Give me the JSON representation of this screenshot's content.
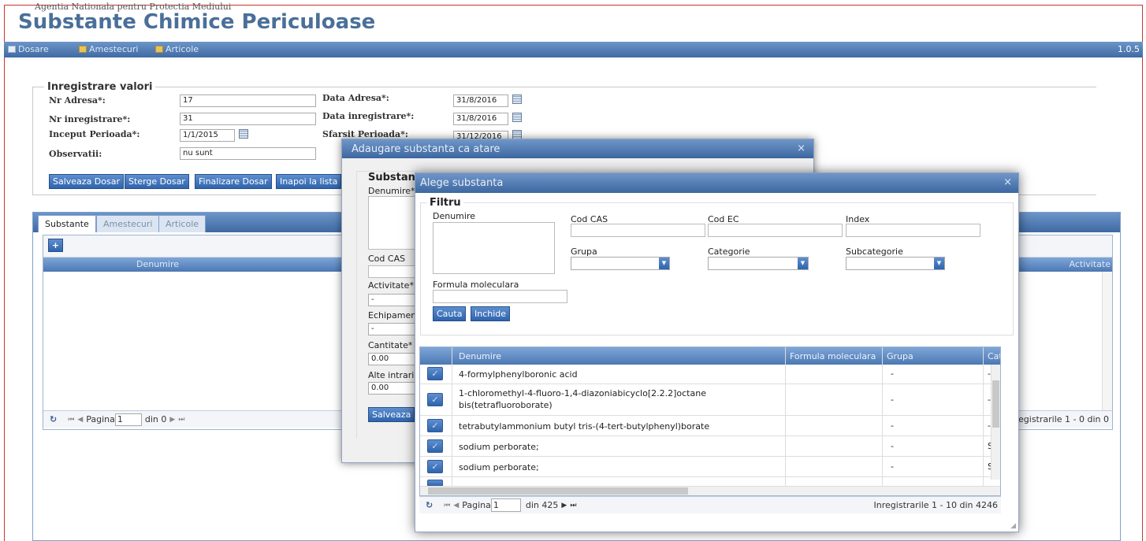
{
  "app": {
    "agency": "Agentia Nationala pentru Protectia Mediului",
    "title": "Substante Chimice Periculoase",
    "version": "1.0.5"
  },
  "menu": {
    "dosare": "Dosare",
    "amestecuri": "Amestecuri",
    "articole": "Articole"
  },
  "form": {
    "legend": "Inregistrare valori",
    "nr_adresa_label": "Nr Adresa*:",
    "nr_adresa_value": "17",
    "nr_inregistrare_label": "Nr inregistrare*:",
    "nr_inregistrare_value": "31",
    "inceput_label": "Inceput Perioada*:",
    "inceput_value": "1/1/2015",
    "observatii_label": "Observatii:",
    "observatii_value": "nu sunt",
    "data_adresa_label": "Data Adresa*:",
    "data_adresa_value": "31/8/2016",
    "data_inreg_label": "Data inregistrare*:",
    "data_inreg_value": "31/8/2016",
    "sfarsit_label": "Sfarsit Perioada*:",
    "sfarsit_value": "31/12/2016",
    "buttons": {
      "salveaza": "Salveaza Dosar",
      "sterge": "Sterge Dosar",
      "finalizare": "Finalizare Dosar",
      "inapoi": "Inapoi la lista"
    }
  },
  "tabs": {
    "substante": "Substante",
    "amestecuri": "Amestecuri",
    "articole": "Articole"
  },
  "main_grid": {
    "add": "+",
    "col_denumire": "Denumire",
    "col_activitate": "Activitate",
    "pager_pagina": "Pagina",
    "pager_page": "1",
    "pager_din": "din 0",
    "pager_info": "Inregistrarile 1 - 0 din 0"
  },
  "dialog1": {
    "title": "Adaugare substanta ca atare",
    "legend": "Substant",
    "denumire_label": "Denumire*",
    "cod_cas_label": "Cod CAS",
    "activitate_label": "Activitate*",
    "activitate_value": "-",
    "echipament_label": "Echipamen",
    "echipament_value": "-",
    "cantitate_label": "Cantitate*",
    "cantitate_value": "0.00",
    "alte_label": "Alte intrari",
    "alte_value": "0.00",
    "salveaza": "Salveaza"
  },
  "dialog2": {
    "title": "Alege substanta",
    "filter": {
      "legend": "Filtru",
      "denumire": "Denumire",
      "cod_cas": "Cod CAS",
      "cod_ec": "Cod EC",
      "index": "Index",
      "grupa": "Grupa",
      "categorie": "Categorie",
      "subcategorie": "Subcategorie",
      "formula": "Formula moleculara",
      "cauta": "Cauta",
      "inchide": "Inchide"
    },
    "grid": {
      "columns": [
        "Denumire",
        "Formula moleculara",
        "Grupa",
        "Cat"
      ],
      "rows": [
        {
          "denumire": "4-formylphenylboronic acid",
          "formula": "",
          "grupa": "-",
          "cat": "-"
        },
        {
          "denumire": "1-chloromethyl-4-fluoro-1,4-diazoniabicyclo[2.2.2]octane bis(tetrafluoroborate)",
          "line1": "1-chloromethyl-4-fluoro-1,4-diazoniabicyclo[2.2.2]octane",
          "line2": "bis(tetrafluoroborate)",
          "formula": "",
          "grupa": "-",
          "cat": "-"
        },
        {
          "denumire": "tetrabutylammonium butyl tris-(4-tert-butylphenyl)borate",
          "formula": "",
          "grupa": "-",
          "cat": "-"
        },
        {
          "denumire": "sodium perborate;",
          "formula": "",
          "grupa": "-",
          "cat": "SVH"
        },
        {
          "denumire": "sodium perborate;",
          "formula": "",
          "grupa": "-",
          "cat": "SVH"
        }
      ],
      "pager": {
        "pagina": "Pagina",
        "page": "1",
        "din": "din 425",
        "info": "Inregistrarile 1 - 10 din 4246"
      }
    }
  }
}
